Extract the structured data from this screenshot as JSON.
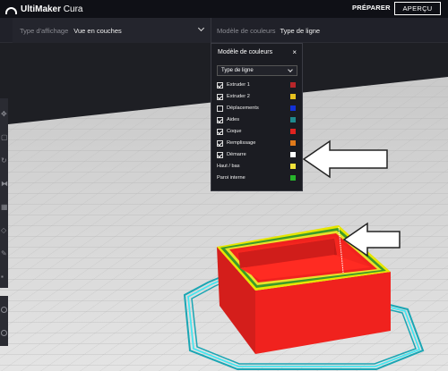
{
  "app": {
    "logo_bold": "UltiMaker",
    "logo_rest": " Cura",
    "prepare_label": "PRÉPARER",
    "preview_label": "APERÇU"
  },
  "header": {
    "view_type_label": "Type d'affichage",
    "view_type_value": "Vue en couches",
    "color_model_label": "Modèle de couleurs",
    "color_model_value": "Type de ligne"
  },
  "popup": {
    "title": "Modèle de couleurs",
    "close": "×",
    "dropdown_value": "Type de ligne",
    "items": [
      {
        "label": "Extruder 1",
        "checked": true,
        "color": "#b8262a"
      },
      {
        "label": "Extruder 2",
        "checked": true,
        "color": "#e7c21f"
      },
      {
        "label": "Déplacements",
        "checked": false,
        "color": "#1231d6"
      },
      {
        "label": "Aides",
        "checked": true,
        "color": "#1f8a8e"
      },
      {
        "label": "Coque",
        "checked": true,
        "color": "#e0231f"
      },
      {
        "label": "Remplissage",
        "checked": true,
        "color": "#e07a1a"
      },
      {
        "label": "Démarre",
        "checked": true,
        "color": "#ffffff"
      }
    ],
    "plain_items": [
      {
        "label": "Haut / bas",
        "color": "#f2e23a"
      },
      {
        "label": "Paroi interne",
        "color": "#27b42b"
      }
    ]
  }
}
